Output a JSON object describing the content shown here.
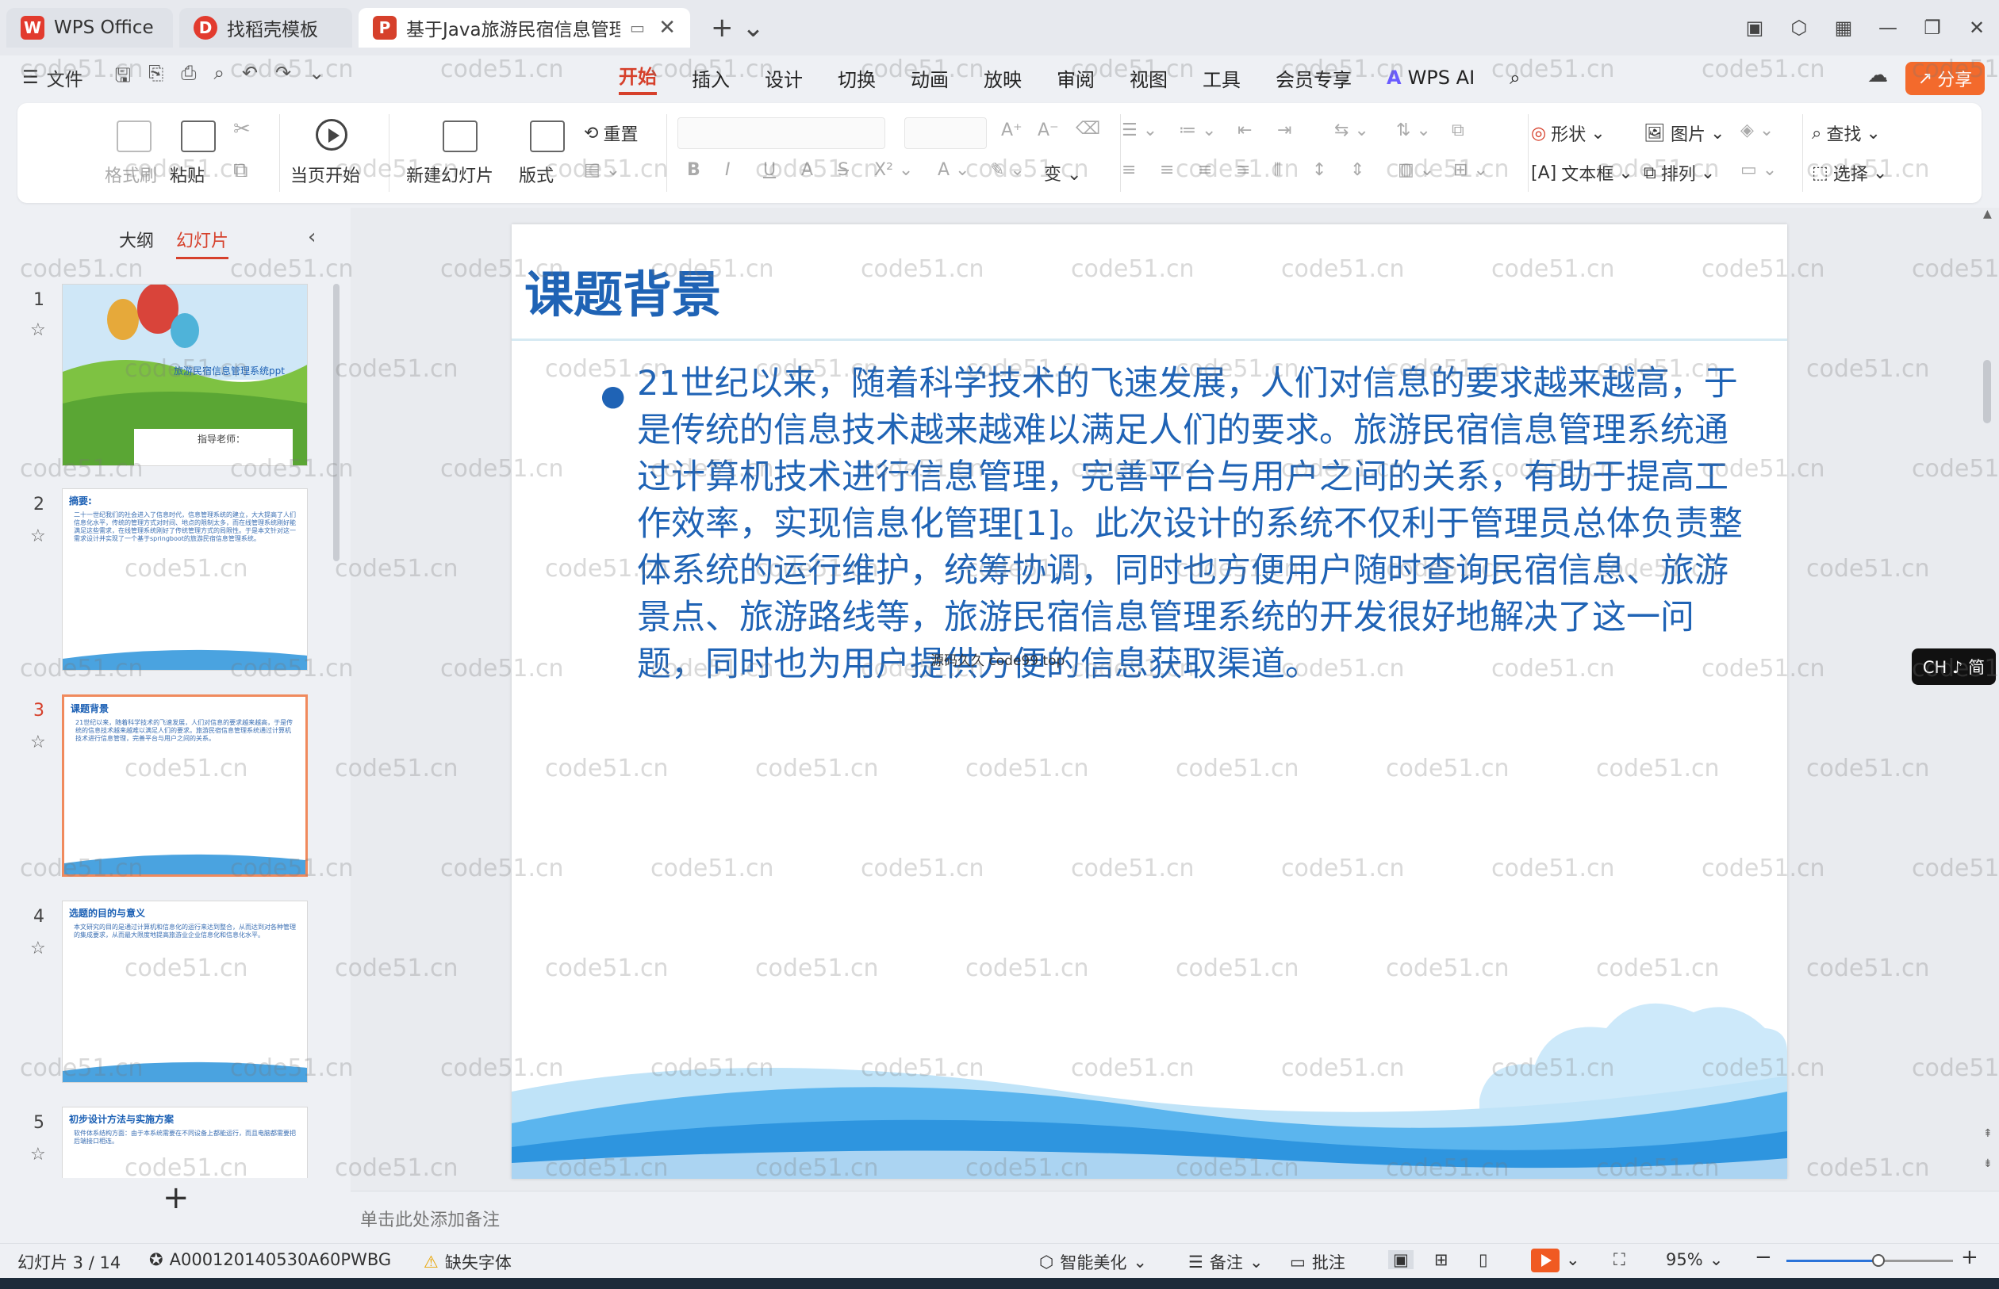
{
  "tabs": [
    {
      "label": "WPS Office",
      "color": "#e23b2e"
    },
    {
      "label": "找稻壳模板",
      "color": "#e23b2e"
    },
    {
      "label": "基于Java旅游民宿信息管理系",
      "color": "#e23b2e"
    }
  ],
  "menubar": {
    "file": "文件",
    "menus": [
      "开始",
      "插入",
      "设计",
      "切换",
      "动画",
      "放映",
      "审阅",
      "视图",
      "工具",
      "会员专享"
    ],
    "active": "开始",
    "ai": "WPS AI",
    "share": "分享"
  },
  "ribbon": {
    "format_painter": "格式刷",
    "paste": "粘贴",
    "from_current": "当页开始",
    "new_slide": "新建幻灯片",
    "layout": "版式",
    "reset": "重置",
    "shape": "形状",
    "picture": "图片",
    "textbox": "文本框",
    "arrange": "排列",
    "find": "查找",
    "select": "选择",
    "bold": "B",
    "italic": "I",
    "underline": "U"
  },
  "leftpanel": {
    "tab_outline": "大纲",
    "tab_slides": "幻灯片",
    "thumbs": [
      {
        "num": "1",
        "title": "旅游民宿信息管理系统ppt",
        "sub": "指导老师："
      },
      {
        "num": "2",
        "title": "摘要:",
        "body": "二十一世纪我们的社会进入了信息时代，信息管理系统的建立，大大提高了人们信息化水平，传统的管理方式对时间、地点的限制太多，而在线管理系统刚好能满足这些需求，在线管理系统刚好了传统管理方式的局限性。于是本文针对这一需求设计并实现了一个基于springboot的旅游民宿信息管理系统。"
      },
      {
        "num": "3",
        "title": "课题背景",
        "body": "21世纪以来，随着科学技术的飞速发展，人们对信息的要求越来越高，于是传统的信息技术越来越难以满足人们的要求。旅游民宿信息管理系统通过计算机技术进行信息管理，完善平台与用户之间的关系。"
      },
      {
        "num": "4",
        "title": "选题的目的与意义",
        "body": "本文研究的目的是通过计算机和信息化的运行来达到整合，从而达到对各种管理的集成要求，从而最大限度地提高旅游业企业信息化和信息化水平。"
      },
      {
        "num": "5",
        "title": "初步设计方法与实施方案",
        "body": "软件体系结构方面：由于本系统需要在不同设备上都能运行，而且电脑都需要把后端接口相连。"
      }
    ]
  },
  "slide": {
    "title": "课题背景",
    "body": "21世纪以来，随着科学技术的飞速发展，人们对信息的要求越来越高，于是传统的信息技术越来越难以满足人们的要求。旅游民宿信息管理系统通过计算机技术进行信息管理，完善平台与用户之间的关系，有助于提高工作效率，实现信息化管理[1]。此次设计的系统不仅利于管理员总体负责整体系统的运行维护，统筹协调，同时也方便用户随时查询民宿信息、旅游景点、旅游路线等，旅游民宿信息管理系统的开发很好地解决了这一问题，同时也为用户提供方便的信息获取渠道。",
    "note": "源码久久 code99.top",
    "accent": "#1f63b5"
  },
  "notes_placeholder": "单击此处添加备注",
  "statusbar": {
    "slide_info": "幻灯片 3 / 14",
    "doc_id": "A000120140530A60PWBG",
    "missing_font": "缺失字体",
    "beautify": "智能美化",
    "notes": "备注",
    "comments": "批注",
    "zoom": "95%",
    "zoom_level": 0.55
  },
  "ime": "CH ♪ 简",
  "watermark": "code51.cn"
}
